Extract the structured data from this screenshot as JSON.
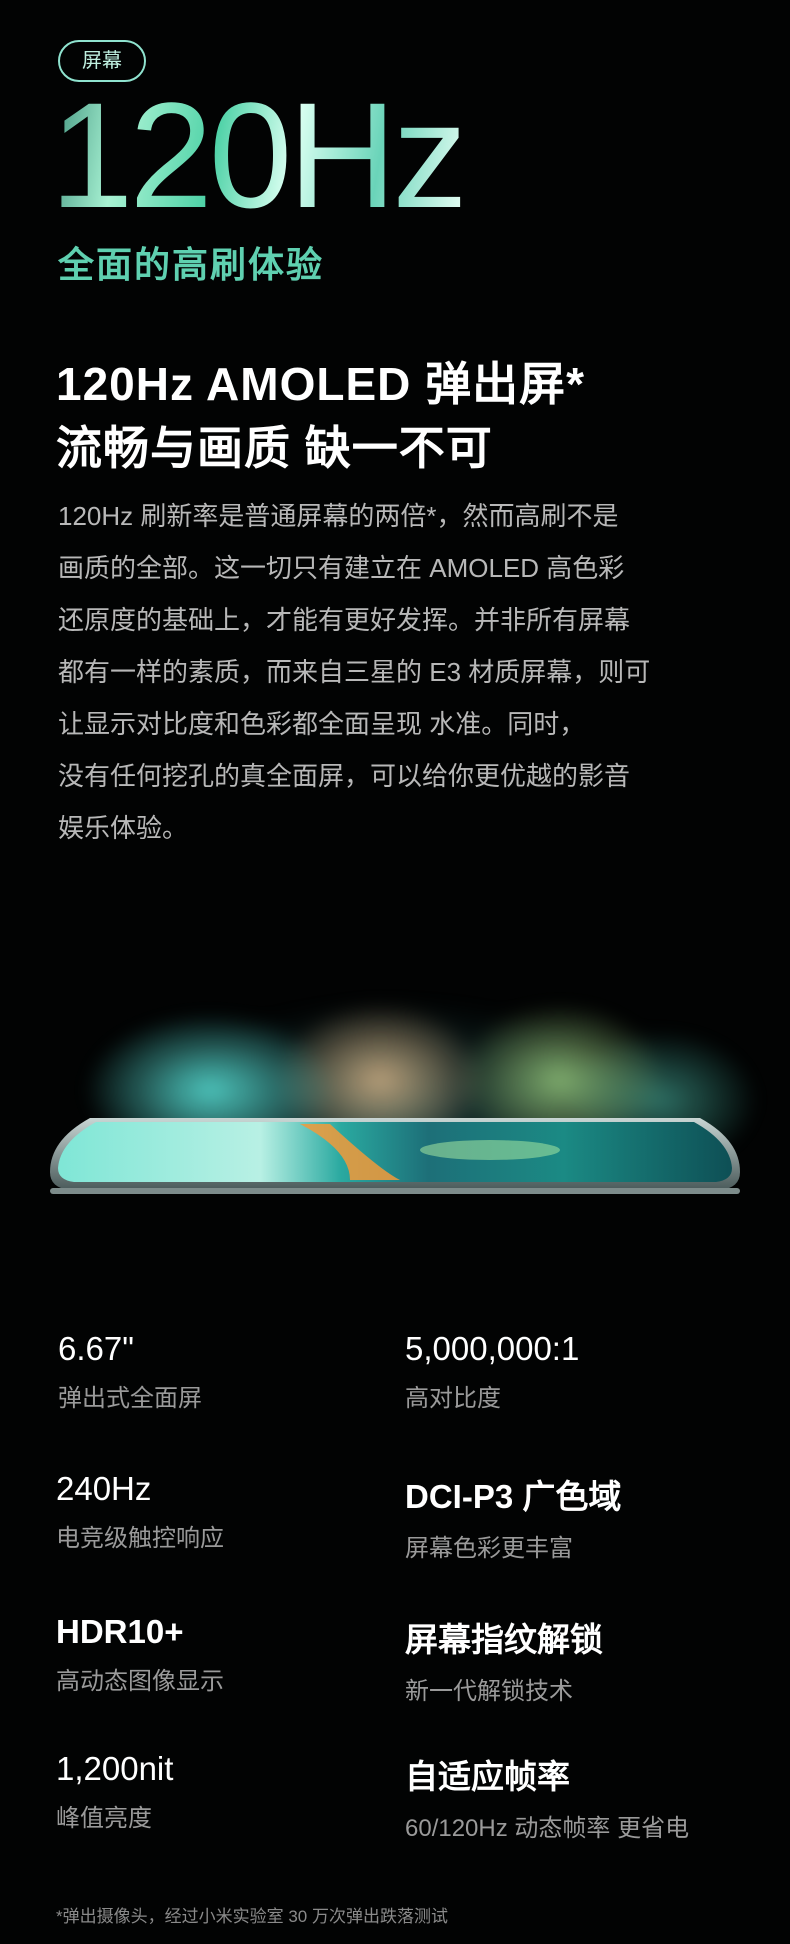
{
  "tag": "屏幕",
  "hero": {
    "title": "120Hz",
    "subtitle": "全面的高刷体验"
  },
  "headline": {
    "line1": "120Hz AMOLED  弹出屏*",
    "line2": "流畅与画质 缺一不可"
  },
  "body_lines": [
    "120Hz 刷新率是普通屏幕的两倍*，然而高刷不是",
    "画质的全部。这一切只有建立在 AMOLED 高色彩",
    "还原度的基础上，才能有更好发挥。并非所有屏幕",
    "都有一样的素质，而来自三星的 E3 材质屏幕，则可",
    "让显示对比度和色彩都全面呈现 水准。同时，",
    "没有任何挖孔的真全面屏，可以给你更优越的影音",
    "娱乐体验。"
  ],
  "specs": [
    {
      "value": "6.67\"",
      "label": "弹出式全面屏"
    },
    {
      "value": "5,000,000:1",
      "label": "高对比度"
    },
    {
      "value": "240Hz",
      "label": "电竞级触控响应"
    },
    {
      "value": "DCI-P3 广色域",
      "label": "屏幕色彩更丰富"
    },
    {
      "value": "HDR10+",
      "label": "高动态图像显示"
    },
    {
      "value": "屏幕指纹解锁",
      "label": "新一代解锁技术"
    },
    {
      "value": "1,200nit",
      "label": "峰值亮度"
    },
    {
      "value": "自适应帧率",
      "label": "60/120Hz 动态帧率 更省电"
    }
  ],
  "footnote": "*弹出摄像头，经过小米实验室 30 万次弹出跌落测试",
  "colors": {
    "accent": "#5fd0b0",
    "background": "#020303",
    "body_text": "#b8b8b8"
  }
}
